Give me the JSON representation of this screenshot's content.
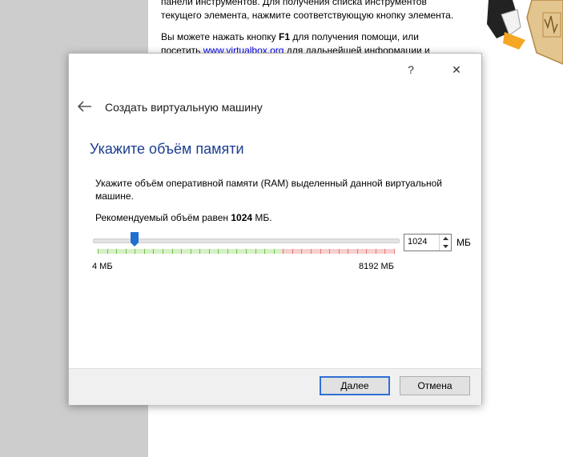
{
  "background": {
    "line1": "панели инструментов. Для получения списка инструментов",
    "line2": "текущего элемента, нажмите соответствующую кнопку элемента.",
    "help_prefix": "Вы можете нажать кнопку ",
    "help_key": "F1",
    "help_suffix": " для получения помощи, или",
    "visit_prefix": "посетить ",
    "link": "www.virtualbox.org",
    "visit_suffix": " для дальнейшей информации и"
  },
  "dialog": {
    "help_btn": "?",
    "close_btn": "✕",
    "header_title": "Создать виртуальную машину",
    "page_title": "Укажите объём памяти",
    "description": "Укажите объём оперативной памяти (RAM) выделенный данной виртуальной машине.",
    "recommend_prefix": "Рекомендуемый объём равен ",
    "recommend_value": "1024",
    "recommend_suffix": " МБ.",
    "slider": {
      "min_label": "4 МБ",
      "max_label": "8192 МБ",
      "value": 1024,
      "min": 4,
      "max": 8192
    },
    "spin_value": "1024",
    "unit": "МБ",
    "next_label": "Далее",
    "cancel_label": "Отмена"
  },
  "colors": {
    "accent": "#1c3e8f",
    "link": "#0000ee",
    "focus": "#2f6fd6"
  }
}
